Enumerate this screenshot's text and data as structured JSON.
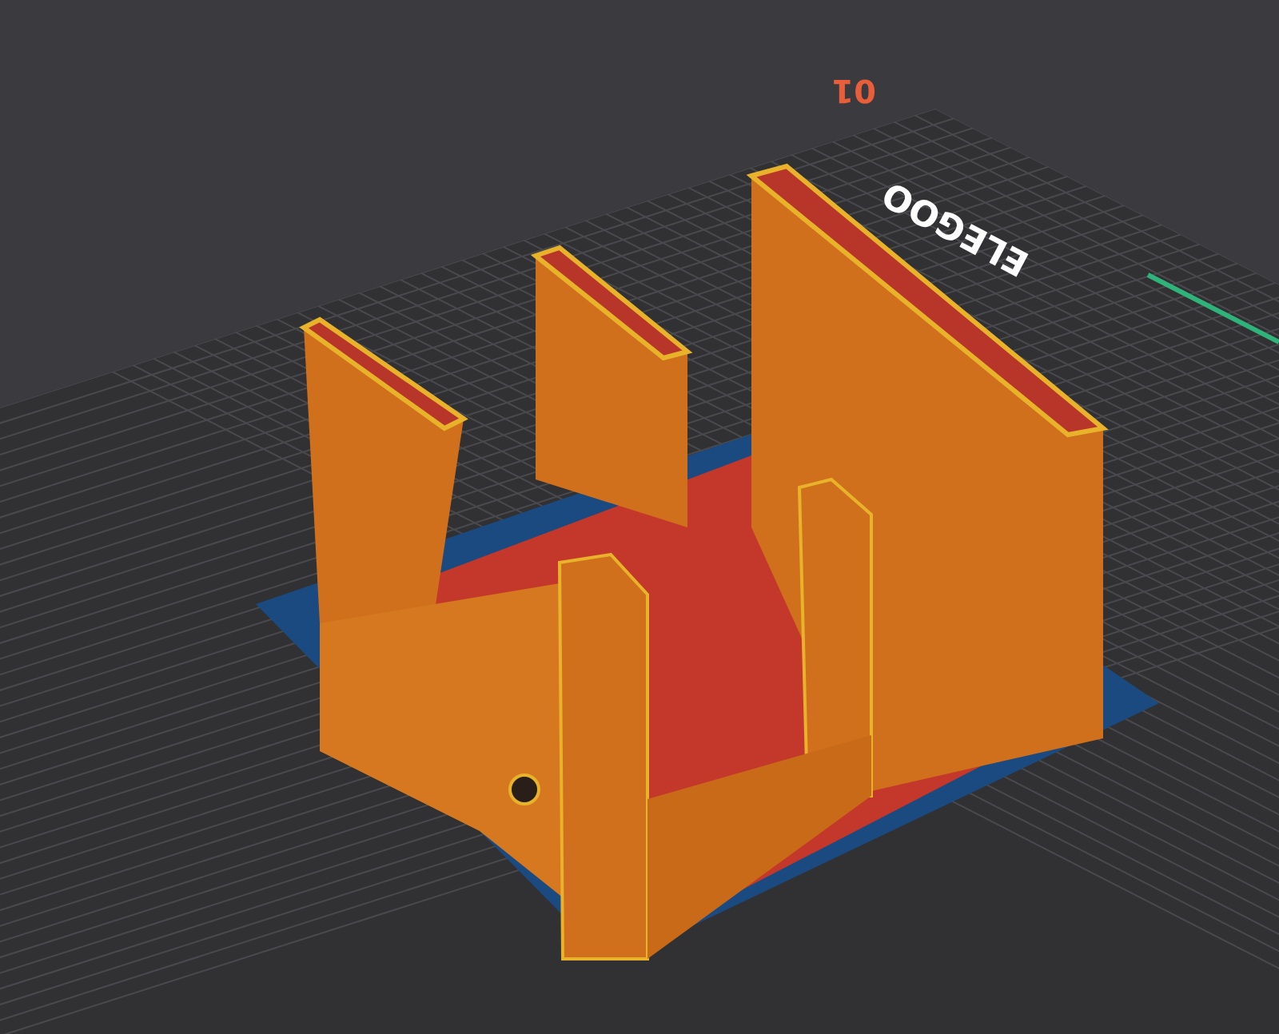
{
  "viewport": {
    "plate_number": "01",
    "bed_logo": "ELEGOO"
  }
}
